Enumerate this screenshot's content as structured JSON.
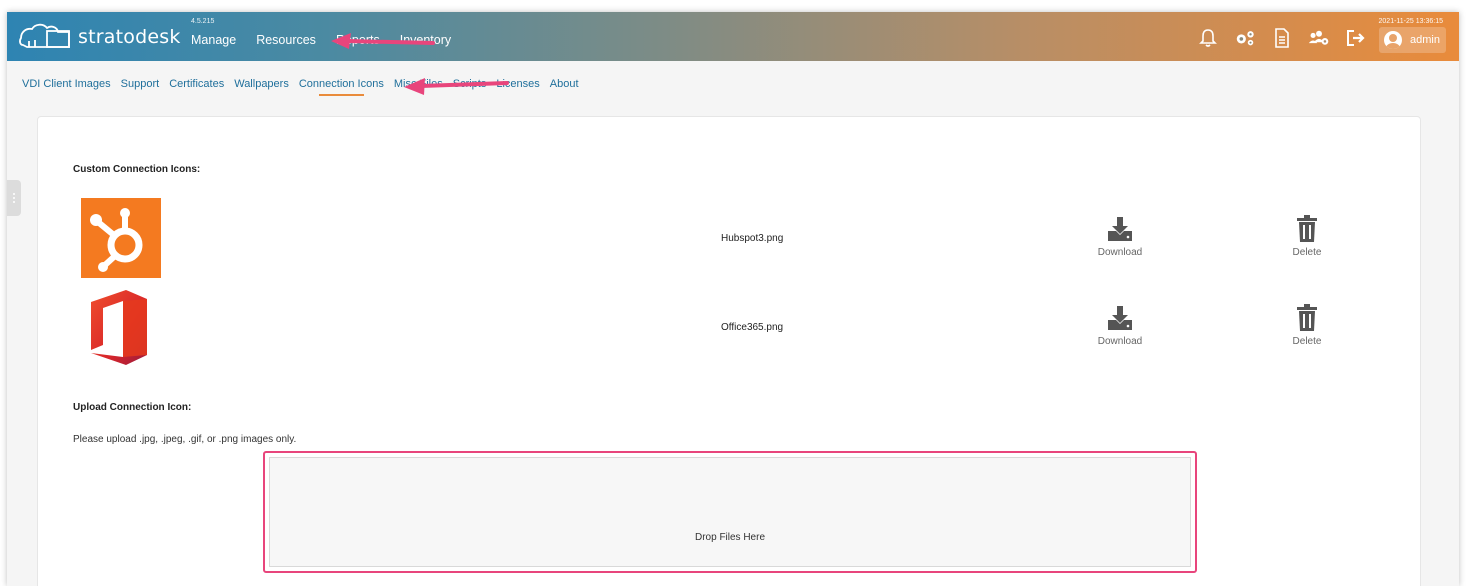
{
  "header": {
    "brand": "stratodesk",
    "version": "4.5.215",
    "timestamp": "2021-11-25 13:36:15",
    "nav": [
      "Manage",
      "Resources",
      "Reports",
      "Inventory"
    ],
    "user": "admin",
    "icons": [
      "bell-icon",
      "gears-icon",
      "document-icon",
      "users-cog-icon",
      "sign-out-icon"
    ]
  },
  "subnav": {
    "items": [
      "VDI Client Images",
      "Support",
      "Certificates",
      "Wallpapers",
      "Connection Icons",
      "Misc Files",
      "Scripts",
      "Licenses",
      "About"
    ],
    "active": "Connection Icons"
  },
  "custom_icons": {
    "title": "Custom Connection Icons:",
    "items": [
      {
        "file": "Hubspot3.png",
        "download_label": "Download",
        "delete_label": "Delete",
        "icon": "hubspot-logo"
      },
      {
        "file": "Office365.png",
        "download_label": "Download",
        "delete_label": "Delete",
        "icon": "office365-logo"
      }
    ]
  },
  "upload": {
    "title": "Upload Connection Icon:",
    "help": "Please upload .jpg, .jpeg, .gif, or .png images only.",
    "drop_label": "Drop Files Here"
  },
  "colors": {
    "header_start": "#2e84b2",
    "header_end": "#e98b3b",
    "link": "#1f6f9b",
    "accent": "#e98b3b",
    "annotation": "#e8457c",
    "hubspot": "#f47a20"
  }
}
